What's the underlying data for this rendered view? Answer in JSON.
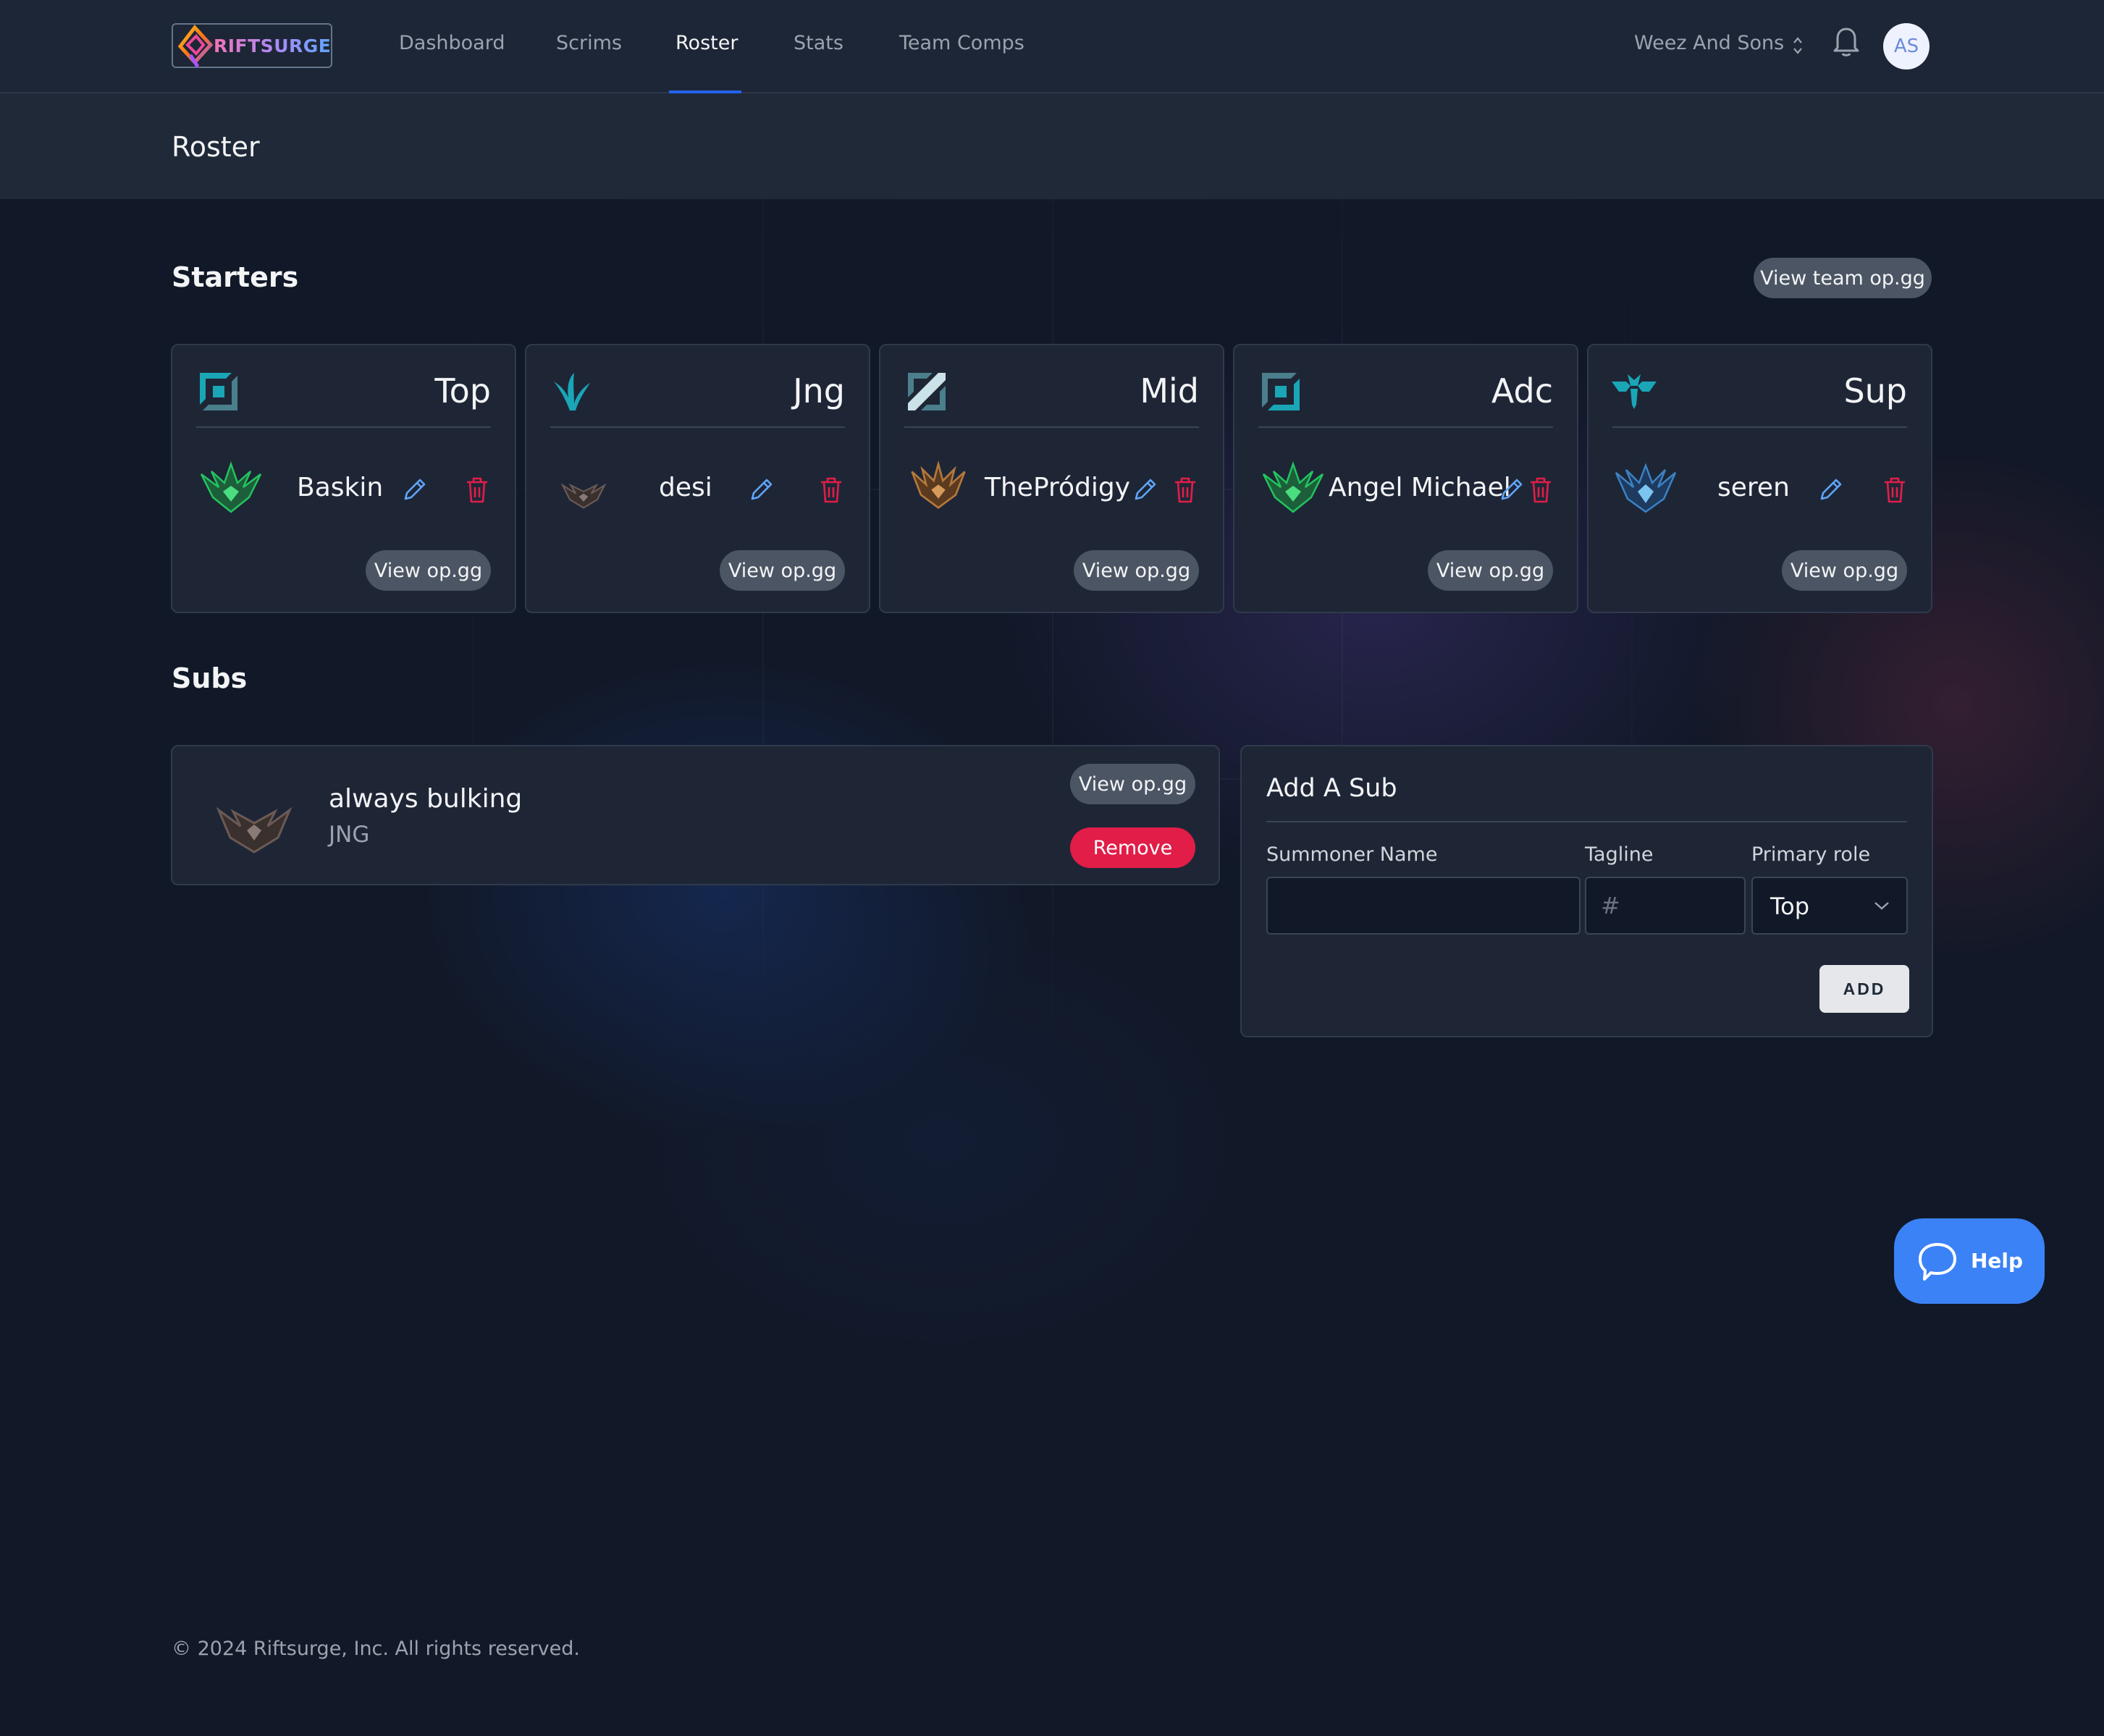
{
  "brand": {
    "name": "RIFTSURGE"
  },
  "nav": {
    "links": [
      "Dashboard",
      "Scrims",
      "Roster",
      "Stats",
      "Team Comps"
    ],
    "active": "Roster",
    "team_switcher": "Weez And Sons",
    "avatar_initials": "AS"
  },
  "page": {
    "title": "Roster"
  },
  "starters": {
    "title": "Starters",
    "view_team_label": "View team op.gg",
    "view_label": "View op.gg",
    "cards": [
      {
        "role": "Top",
        "player": "Baskin",
        "role_icon": "top-lane-icon",
        "rank_icon": "emerald-emblem-icon",
        "rank_color": "#22c55e"
      },
      {
        "role": "Jng",
        "player": "desi",
        "role_icon": "jungle-icon",
        "rank_icon": "iron-emblem-icon",
        "rank_color": "#6b5a55"
      },
      {
        "role": "Mid",
        "player": "ThePródigy",
        "role_icon": "mid-lane-icon",
        "rank_icon": "bronze-emblem-icon",
        "rank_color": "#b4783c"
      },
      {
        "role": "Adc",
        "player": "Angel Michael",
        "role_icon": "bot-lane-icon",
        "rank_icon": "emerald-emblem-icon",
        "rank_color": "#22c55e"
      },
      {
        "role": "Sup",
        "player": "seren",
        "role_icon": "support-icon",
        "rank_icon": "diamond-emblem-icon",
        "rank_color": "#3b82c4"
      }
    ]
  },
  "subs": {
    "title": "Subs",
    "list": [
      {
        "name": "always bulking",
        "role": "JNG",
        "view_label": "View op.gg",
        "remove_label": "Remove",
        "rank_icon": "iron-emblem-icon"
      }
    ]
  },
  "add_sub": {
    "title": "Add A Sub",
    "summoner_label": "Summoner Name",
    "summoner_value": "",
    "tagline_label": "Tagline",
    "tagline_placeholder": "#",
    "role_label": "Primary role",
    "role_value": "Top",
    "add_label": "ADD"
  },
  "help": {
    "label": "Help"
  },
  "footer": {
    "text": "© 2024 Riftsurge, Inc. All rights reserved."
  },
  "colors": {
    "accent": "#2563eb",
    "danger": "#e11d48",
    "teal_role": "#1aa6b7",
    "help_bg": "#3b82f6"
  }
}
